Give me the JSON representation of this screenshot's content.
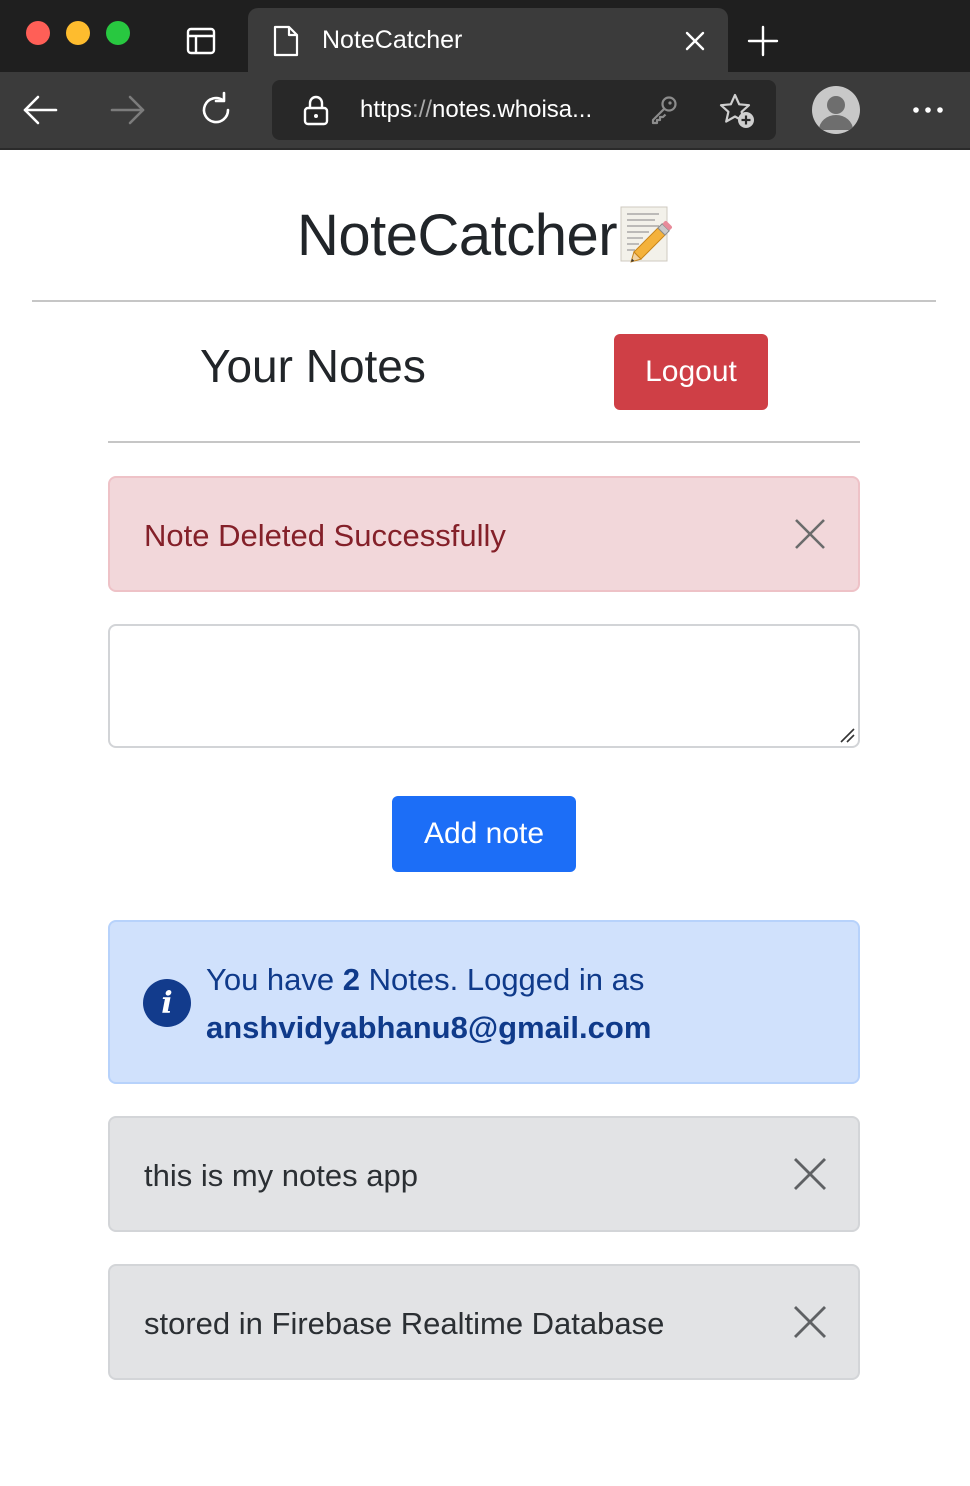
{
  "browser": {
    "tab_title": "NoteCatcher",
    "url_scheme": "https",
    "url_separator": "://",
    "url_rest": "notes.whoisa..."
  },
  "page": {
    "brand": "NoteCatcher",
    "heading": "Your Notes",
    "logout_label": "Logout",
    "alert_message": "Note Deleted Successfully",
    "note_input": {
      "value": "",
      "placeholder": ""
    },
    "add_note_label": "Add note",
    "info": {
      "prefix": "You have ",
      "count": "2",
      "suffix": " Notes. Logged in as",
      "email": "anshvidyabhanu8@gmail.com"
    },
    "notes": [
      {
        "text": "this is my notes app"
      },
      {
        "text": "stored in Firebase Realtime Database"
      }
    ]
  },
  "colors": {
    "danger": "#cf3f46",
    "primary": "#1c6ef7",
    "alert_danger_bg": "#f2d7da",
    "alert_info_bg": "#d0e1fc",
    "note_bg": "#e2e3e5"
  },
  "icons": [
    "tab-actions-icon",
    "page-icon",
    "close-icon",
    "plus-icon",
    "back-arrow-icon",
    "forward-arrow-icon",
    "reload-icon",
    "lock-icon",
    "key-icon",
    "favorite-add-icon",
    "profile-avatar",
    "more-icon",
    "memo-icon",
    "info-icon"
  ]
}
